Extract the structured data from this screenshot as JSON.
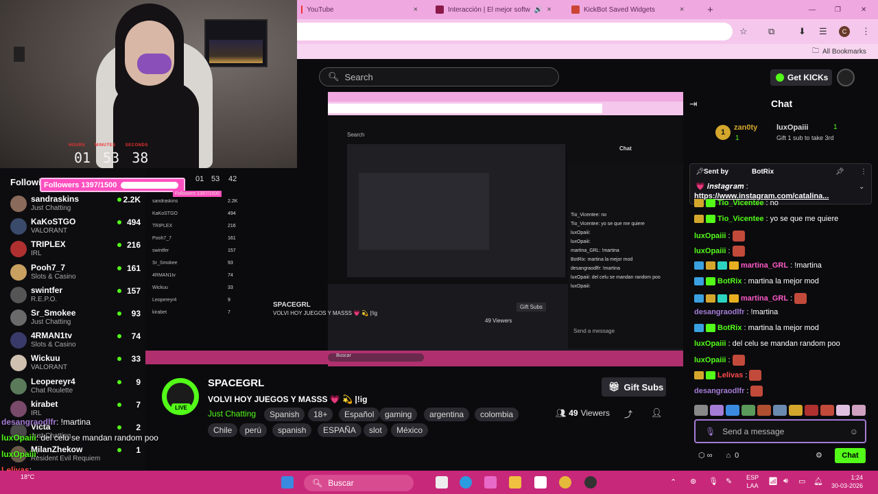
{
  "webcam": {
    "timer": {
      "labels": [
        "HOURS",
        "MINUTES",
        "SECONDS"
      ],
      "hours": "01",
      "minutes": "53",
      "seconds": "38"
    }
  },
  "following": {
    "heading": "Following",
    "followers_badge": "Followers 1397/1500",
    "items": [
      {
        "name": "sandraskins",
        "category": "Just Chatting",
        "count": "2.2K"
      },
      {
        "name": "KaKoSTGO",
        "category": "VALORANT",
        "count": "494"
      },
      {
        "name": "TRIPLEX",
        "category": "IRL",
        "count": "216"
      },
      {
        "name": "Pooh7_7",
        "category": "Slots & Casino",
        "count": "161"
      },
      {
        "name": "swintfer",
        "category": "R.E.P.O.",
        "count": "157"
      },
      {
        "name": "Sr_Smokee",
        "category": "Just Chatting",
        "count": "93"
      },
      {
        "name": "4RMAN1tv",
        "category": "Slots & Casino",
        "count": "74"
      },
      {
        "name": "Wickuu",
        "category": "VALORANT",
        "count": "33"
      },
      {
        "name": "Leopereyr4",
        "category": "Chat Roulette",
        "count": "9"
      },
      {
        "name": "kirabet",
        "category": "IRL",
        "count": "7"
      },
      {
        "name": "Victa",
        "category": "Just Chatting",
        "count": "2"
      },
      {
        "name": "MilanZhekow",
        "category": "Resident Evil Requiem",
        "count": "1"
      }
    ]
  },
  "overlay_chat": [
    {
      "user": "desangraodlfr",
      "text": ": !martina"
    },
    {
      "user": "luxOpaiii",
      "text": ": del celu se mandan random poo"
    },
    {
      "user": "luxOpaiii",
      "text": ":"
    },
    {
      "user": "Lelivas",
      "text": ":"
    },
    {
      "user": "desangraodlfr",
      "text": ":"
    }
  ],
  "browser": {
    "tabs": [
      {
        "label": "YouTube",
        "close": "×"
      },
      {
        "label": "Interacción | El mejor softw",
        "close": "×"
      },
      {
        "label": "KickBot Saved Widgets",
        "close": "×"
      }
    ],
    "new_tab": "+",
    "window_controls": {
      "minimize": "—",
      "maximize": "❐",
      "close": "✕"
    },
    "profile_initial": "C",
    "bookmarks_label": "All Bookmarks"
  },
  "kick": {
    "search_placeholder": "Search",
    "get_kicks": "Get KICKs",
    "stream": {
      "name": "SPACEGRL",
      "title": "VOLVI HOY JUEGOS Y MASSS 💗 💫 |!ig",
      "category": "Just Chatting",
      "live": "LIVE",
      "tags": [
        "Spanish",
        "18+",
        "Español",
        "gaming",
        "argentina",
        "colombia",
        "Chile",
        "perú",
        "spanish",
        "ESPAÑA",
        "slot",
        "México"
      ],
      "viewers": "49",
      "viewers_label": "Viewers",
      "gift_subs": "Gift Subs"
    },
    "chat": {
      "title": "Chat",
      "gifts": [
        {
          "user": "zan0ty",
          "count": "1",
          "rank": "1"
        },
        {
          "user": "luxOpaiii",
          "count": "1",
          "note": "Gift 1 sub to take 3rd"
        }
      ],
      "pinned": {
        "sent_by_label": "Sent by",
        "sent_by": "BotRix",
        "line1": "💗 𝒊𝒏𝒔𝒕𝒂𝒈𝒓𝒂𝒎 :",
        "link": "https://www.instagram.com/catalina..."
      },
      "messages": [
        {
          "user": "Tio_Vicentee",
          "text": ": no",
          "color": "#53fc18"
        },
        {
          "user": "Tio_Vicentee",
          "text": ": yo se que me quiere",
          "color": "#53fc18"
        },
        {
          "user": "luxOpaiii",
          "text": ":",
          "color": "#53fc18"
        },
        {
          "user": "luxOpaiii",
          "text": ":",
          "color": "#53fc18"
        },
        {
          "user": "martina_GRL",
          "text": ": !martina",
          "color": "#ff5ac8"
        },
        {
          "user": "BotRix",
          "text": ": martina la mejor mod",
          "color": "#53fc18"
        },
        {
          "user": "martina_GRL",
          "text": ":",
          "color": "#ff5ac8"
        },
        {
          "user": "desangraodlfr",
          "text": ": !martina",
          "color": "#a57cd6"
        },
        {
          "user": "BotRix",
          "text": ": martina la mejor mod",
          "color": "#53fc18"
        },
        {
          "user": "luxOpaiii",
          "text": ": del celu se mandan random poo",
          "color": "#53fc18"
        },
        {
          "user": "luxOpaiii",
          "text": ":",
          "color": "#53fc18"
        },
        {
          "user": "Lelivas",
          "text": ":",
          "color": "#ff4a4a"
        },
        {
          "user": "desangraodlfr",
          "text": ":",
          "color": "#a57cd6"
        }
      ],
      "input_placeholder": "Send a message",
      "send_label": "Chat",
      "footer_count": "0"
    }
  },
  "nested": {
    "stream_name": "SPACEGRL",
    "stream_title": "VOLVI HOY JUEGOS Y MASSS 💗 💫 |!ig",
    "viewers": "49 Viewers",
    "gift_subs": "Gift Subs",
    "chat_title": "Chat",
    "search": "Search",
    "send": "Send a message",
    "taskbar_search": "Buscar",
    "timer": [
      "01",
      "53",
      "42"
    ],
    "followers_badge": "Followers 1397/1500",
    "chat_lines": [
      "Tio_Vicentee: no",
      "Tio_Vicentee: yo se que me quiere",
      "luxOpaiii:",
      "luxOpaiii:",
      "martina_GRL: !martina",
      "BotRix: martina la mejor mod",
      "desangraodlfr: !martina",
      "luxOpaiii: del celu se mandan random poo",
      "luxOpaiii:"
    ],
    "list": [
      {
        "name": "sandraskins",
        "count": "2.2K"
      },
      {
        "name": "KaKoSTGO",
        "count": "494"
      },
      {
        "name": "TRIPLEX",
        "count": "216"
      },
      {
        "name": "Pooh7_7",
        "count": "161"
      },
      {
        "name": "swintfer",
        "count": "157"
      },
      {
        "name": "Sr_Smokee",
        "count": "93"
      },
      {
        "name": "4RMAN1tv",
        "count": "74"
      },
      {
        "name": "Wickuu",
        "count": "33"
      },
      {
        "name": "Leopereyr4",
        "count": "9"
      },
      {
        "name": "kirabet",
        "count": "7"
      }
    ]
  },
  "taskbar": {
    "search": "Buscar",
    "weather": "18°C",
    "lang1": "ESP",
    "lang2": "LAA",
    "time": "1:24",
    "date": "30-03-2026"
  }
}
